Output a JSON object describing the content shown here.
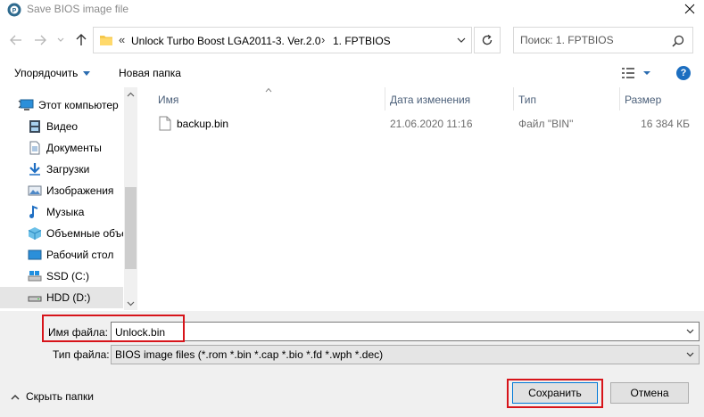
{
  "window": {
    "title": "Save BIOS image file"
  },
  "address": {
    "overflow": "«",
    "crumbs": [
      "Unlock Turbo Boost LGA2011-3. Ver.2.0",
      "1. FPTBIOS"
    ],
    "separator": "›"
  },
  "search": {
    "placeholder": "Поиск: 1. FPTBIOS"
  },
  "toolbar": {
    "organize": "Упорядочить",
    "new_folder": "Новая папка",
    "help": "?"
  },
  "nav": {
    "items": [
      {
        "label": "Этот компьютер",
        "icon": "computer-icon"
      },
      {
        "label": "Видео",
        "icon": "video-icon"
      },
      {
        "label": "Документы",
        "icon": "documents-icon"
      },
      {
        "label": "Загрузки",
        "icon": "downloads-icon"
      },
      {
        "label": "Изображения",
        "icon": "pictures-icon"
      },
      {
        "label": "Музыка",
        "icon": "music-icon"
      },
      {
        "label": "Объемные объекты",
        "icon": "3d-objects-icon"
      },
      {
        "label": "Рабочий стол",
        "icon": "desktop-icon"
      },
      {
        "label": "SSD (C:)",
        "icon": "drive-c-icon"
      },
      {
        "label": "HDD (D:)",
        "icon": "drive-d-icon"
      }
    ]
  },
  "columns": {
    "name": "Имя",
    "date": "Дата изменения",
    "type": "Тип",
    "size": "Размер"
  },
  "files": [
    {
      "name": "backup.bin",
      "date": "21.06.2020 11:16",
      "type": "Файл \"BIN\"",
      "size": "16 384 КБ"
    }
  ],
  "form": {
    "filename_label": "Имя файла:",
    "filename_value": "Unlock.bin",
    "filetype_label": "Тип файла:",
    "filetype_value": "BIOS image files (*.rom *.bin *.cap *.bio *.fd *.wph *.dec)"
  },
  "footer": {
    "hide_folders": "Скрыть папки",
    "save": "Сохранить",
    "cancel": "Отмена"
  },
  "colors": {
    "accent": "#0078d7",
    "highlight": "#d7141a",
    "help": "#1c6ec0",
    "header_text": "#4c607a"
  }
}
